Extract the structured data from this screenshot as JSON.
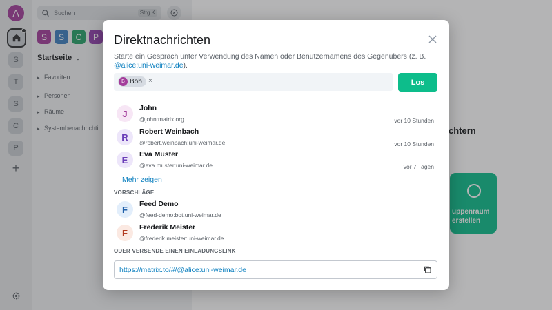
{
  "rail": {
    "avatar_letter": "A",
    "spaces": [
      "S",
      "T",
      "S",
      "C",
      "P"
    ]
  },
  "roomlist": {
    "search_placeholder": "Suchen",
    "search_shortcut": "Strg K",
    "chips": [
      {
        "letter": "S",
        "color": "#a33d9b"
      },
      {
        "letter": "S",
        "color": "#3d7fbf"
      },
      {
        "letter": "C",
        "color": "#26a269"
      },
      {
        "letter": "P",
        "color": "#9141ac"
      }
    ],
    "home_title": "Startseite",
    "sections": [
      "Favoriten",
      "Personen",
      "Räume",
      "Systembenachrichti"
    ]
  },
  "main": {
    "heading_fragment": "chtern",
    "card_line1": "uppenraum",
    "card_line2": "erstellen"
  },
  "dialog": {
    "title": "Direktnachrichten",
    "description": "Starte ein Gespräch unter Verwendung des Namen oder Benutzernamens des Gegenübers (z. B.",
    "description_link": "@alice:uni-weimar.de",
    "description_end": ").",
    "selected_pill": {
      "initial": "B",
      "name": "Bob"
    },
    "go_label": "Los",
    "results": [
      {
        "initial": "J",
        "name": "John",
        "id": "@john:matrix.org",
        "time": "vor 10 Stunden",
        "bg": "#f7e6f5",
        "fg": "#a33d9b"
      },
      {
        "initial": "R",
        "name": "Robert Weinbach",
        "id": "@robert.weinbach:uni-weimar.de",
        "time": "vor 10 Stunden",
        "bg": "#ede6fa",
        "fg": "#6a3db8"
      },
      {
        "initial": "E",
        "name": "Eva Muster",
        "id": "@eva.muster:uni-weimar.de",
        "time": "vor 7 Tagen",
        "bg": "#ede6fa",
        "fg": "#6a3db8"
      }
    ],
    "more_label": "Mehr zeigen",
    "suggestions_heading": "VORSCHLÄGE",
    "suggestions": [
      {
        "initial": "F",
        "name": "Feed Demo",
        "id": "@feed-demo:bot.uni-weimar.de",
        "bg": "#e2eefb",
        "fg": "#1f5fa8"
      },
      {
        "initial": "F",
        "name": "Frederik Meister",
        "id": "@frederik.meister:uni-weimar.de",
        "bg": "#fbe9e2",
        "fg": "#b23a1f"
      }
    ],
    "invite_heading": "ODER VERSENDE EINEN EINLADUNGSLINK",
    "invite_link": "https://matrix.to/#/@alice:uni-weimar.de"
  }
}
